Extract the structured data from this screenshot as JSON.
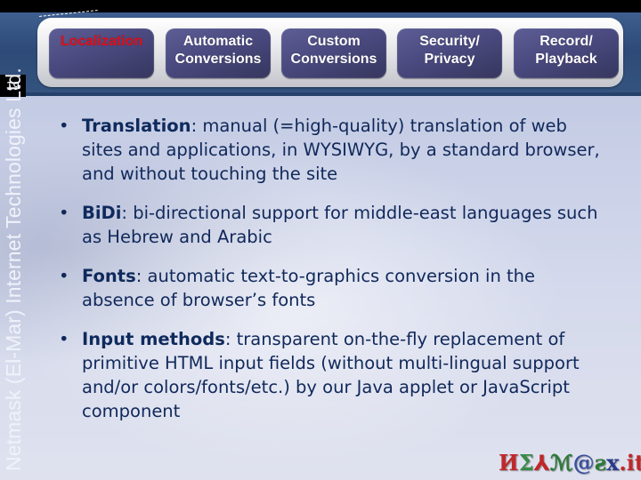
{
  "nav": {
    "tabs": [
      {
        "label": "Localization",
        "active": true
      },
      {
        "label": "Automatic\nConversions",
        "active": false
      },
      {
        "label": "Custom\nConversions",
        "active": false
      },
      {
        "label": "Security/\nPrivacy",
        "active": false
      },
      {
        "label": "Record/\nPlayback",
        "active": false
      }
    ]
  },
  "slide": {
    "number": "19",
    "company_vertical": "Netmask (El-Mar) Internet Technologies Ltd.",
    "bullets": [
      {
        "term": "Translation",
        "text": ": manual (=high-quality) translation of web sites and applications, in WYSIWYG, by a standard browser, and without touching the site"
      },
      {
        "term": "BiDi",
        "text": ": bi-directional support for middle-east languages such as Hebrew and Arabic"
      },
      {
        "term": "Fonts",
        "text": ": automatic text-to-graphics conversion in the absence of browser’s fonts"
      },
      {
        "term": "Input methods",
        "text": ": transparent on-the-fly replacement of primitive HTML input fields (without multi-lingual support and/or colors/fonts/etc.) by our Java applet or JavaScript component"
      }
    ],
    "bullet_symbol": "•"
  },
  "logo": {
    "parts": [
      {
        "text": "И",
        "color": "#c0282a"
      },
      {
        "text": "Σ",
        "color": "#3a8a4a"
      },
      {
        "text": "⅄",
        "color": "#c0282a"
      },
      {
        "text": "ℳ",
        "color": "#2e7a3a"
      },
      {
        "text": "@",
        "color": "#3a50a0"
      },
      {
        "text": "ƨ",
        "color": "#2e7a3a"
      },
      {
        "text": "x",
        "color": "#2a3a8a"
      },
      {
        "text": ".",
        "color": "#c0282a"
      },
      {
        "text": "it!",
        "color": "#c0282a"
      }
    ]
  }
}
